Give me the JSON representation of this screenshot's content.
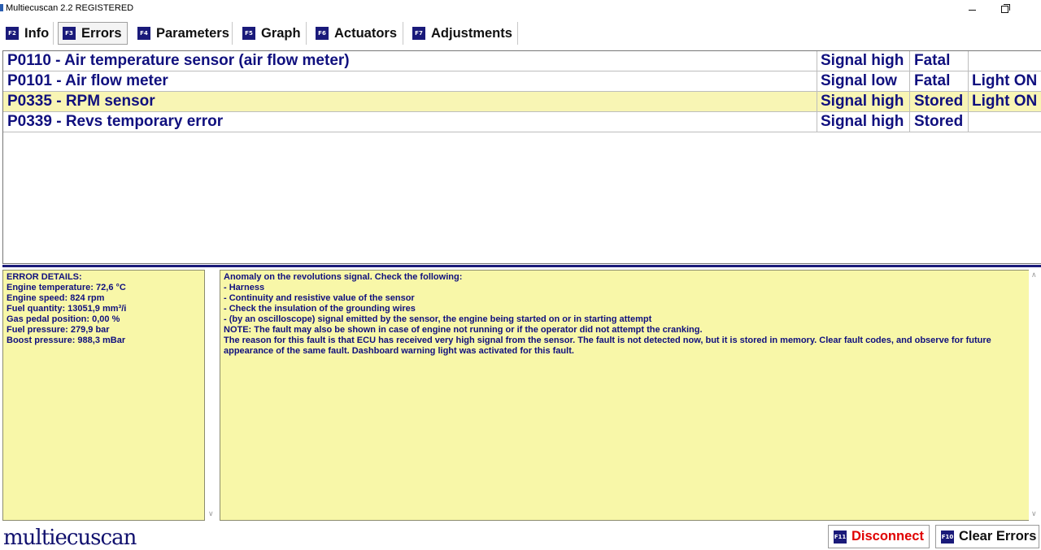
{
  "window": {
    "title": "Multiecuscan 2.2 REGISTERED"
  },
  "tabs": [
    {
      "key": "F2",
      "label": "Info"
    },
    {
      "key": "F3",
      "label": "Errors"
    },
    {
      "key": "F4",
      "label": "Parameters"
    },
    {
      "key": "F5",
      "label": "Graph"
    },
    {
      "key": "F6",
      "label": "Actuators"
    },
    {
      "key": "F7",
      "label": "Adjustments"
    }
  ],
  "active_tab": "Errors",
  "errors": [
    {
      "description": "P0110 - Air temperature sensor (air flow meter)",
      "signal": "Signal high",
      "status": "Fatal",
      "light": ""
    },
    {
      "description": "P0101 - Air flow meter",
      "signal": "Signal low",
      "status": "Fatal",
      "light": "Light ON"
    },
    {
      "description": "P0335 - RPM sensor",
      "signal": "Signal high",
      "status": "Stored",
      "light": "Light ON"
    },
    {
      "description": "P0339 - Revs temporary error",
      "signal": "Signal high",
      "status": "Stored",
      "light": ""
    }
  ],
  "selected_error_index": 2,
  "details": {
    "left_lines": [
      "ERROR DETAILS:",
      "Engine temperature: 72,6 °C",
      "Engine speed: 824 rpm",
      "Fuel quantity: 13051,9 mm³/i",
      "Gas pedal position: 0,00 %",
      "Fuel pressure: 279,9 bar",
      "Boost pressure: 988,3 mBar"
    ],
    "right_lines": [
      "Anomaly on the revolutions signal. Check the following:",
      "- Harness",
      "- Continuity and resistive value of the sensor",
      "- Check the insulation of the grounding wires",
      "- (by an oscilloscope) signal emitted by the sensor, the engine being started on or in starting attempt",
      "NOTE: The fault may also be shown in case of engine not running or if the operator did not attempt the cranking.",
      "The reason for this fault is that ECU has received very high signal from the sensor. The fault is not detected now, but it is stored in memory. Clear fault codes, and observe for future appearance of the same fault. Dashboard warning light was activated for this fault."
    ]
  },
  "footer": {
    "logo": "multiecuscan",
    "disconnect": {
      "key": "F11",
      "label": "Disconnect"
    },
    "clear_errors": {
      "key": "F10",
      "label": "Clear Errors"
    }
  },
  "colors": {
    "text_navy": "#10107e",
    "selected_row": "#f8f5b4",
    "detail_bg": "#f8f7a8",
    "disconnect_red": "#e00000"
  },
  "icons": [
    "app-icon",
    "minimize-icon",
    "maximize-icon",
    "close-icon",
    "scroll-up-icon",
    "scroll-down-icon"
  ]
}
